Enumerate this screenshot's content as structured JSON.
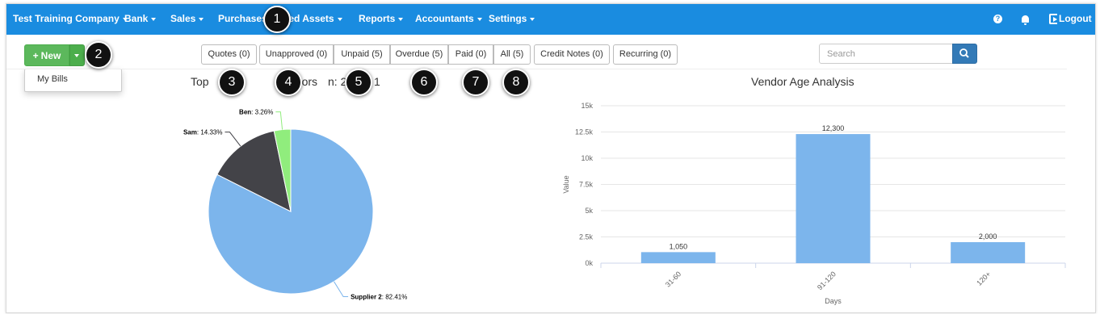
{
  "navbar": {
    "items": [
      {
        "label": "Test Training Company",
        "dropdown": true
      },
      {
        "label": "Bank",
        "dropdown": true
      },
      {
        "label": "Sales",
        "dropdown": true
      },
      {
        "label": "Purchases",
        "dropdown": false
      },
      {
        "label": "Fixed Assets",
        "dropdown": true
      },
      {
        "label": "Reports",
        "dropdown": true
      },
      {
        "label": "Accountants",
        "dropdown": true
      },
      {
        "label": "Settings",
        "dropdown": true
      }
    ],
    "help_icon": "question-circle-icon",
    "notifications_icon": "bell-icon",
    "logout_label": "Logout",
    "color": "#1a8ce0"
  },
  "toolbar": {
    "new_label": "New",
    "new_menu": [
      "My Bills"
    ],
    "filters": [
      {
        "label": "Quotes (0)"
      },
      {
        "label": "Unapproved (0)"
      },
      {
        "label": "Unpaid (5)"
      },
      {
        "label": "Overdue (5)"
      },
      {
        "label": "Paid (0)"
      },
      {
        "label": "All (5)"
      },
      {
        "label": "Credit Notes (0)"
      },
      {
        "label": "Recurring (0)"
      }
    ],
    "search_placeholder": "Search"
  },
  "annotations": [
    "1",
    "2",
    "3",
    "4",
    "5",
    "6",
    "7",
    "8"
  ],
  "pie_title": {
    "left": "Top",
    "middle": "ndors",
    "right": "n: 2015–",
    "end": "1"
  },
  "chart_data": [
    {
      "type": "pie",
      "slices": [
        {
          "name": "Supplier 2",
          "label": "82.41%",
          "value": 82.41,
          "color": "#7cb5ec"
        },
        {
          "name": "Sam",
          "label": "14.33%",
          "value": 14.33,
          "color": "#434348"
        },
        {
          "name": "Ben",
          "label": "3.26%",
          "value": 3.26,
          "color": "#90ed7d"
        }
      ]
    },
    {
      "type": "bar",
      "title": "Vendor Age Analysis",
      "xlabel": "Days",
      "ylabel": "Value",
      "categories": [
        "31-60",
        "91-120",
        "120+"
      ],
      "values": [
        1050,
        12300,
        2000
      ],
      "value_labels": [
        "1,050",
        "12,300",
        "2,000"
      ],
      "ylim": [
        0,
        15000
      ],
      "yticks": [
        "0k",
        "2.5k",
        "5k",
        "7.5k",
        "10k",
        "12.5k",
        "15k"
      ],
      "ytick_values": [
        0,
        2500,
        5000,
        7500,
        10000,
        12500,
        15000
      ],
      "color": "#7cb5ec",
      "grid": true
    }
  ]
}
